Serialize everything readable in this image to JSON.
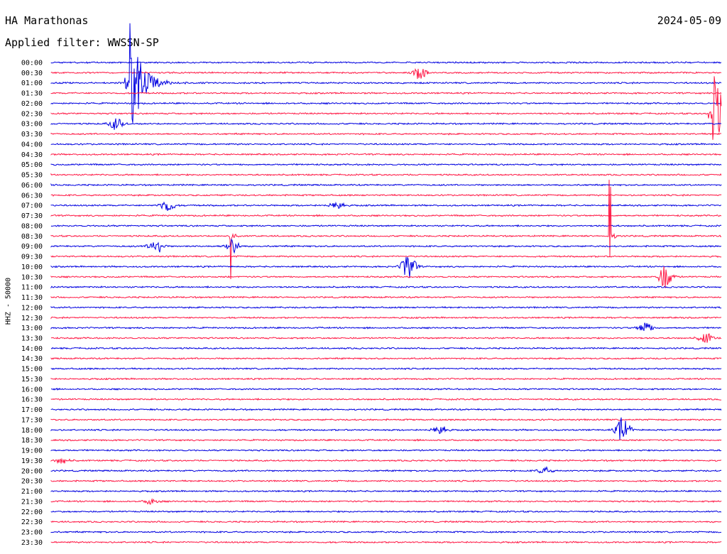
{
  "header": {
    "station": "HA Marathonas",
    "date": "2024-05-09",
    "filter": "Applied filter: WWSSN-SP"
  },
  "colors": {
    "blue": "#0000e0",
    "red": "#ff1744"
  },
  "chart_data": {
    "type": "line",
    "ylabel": "HHZ - 50000",
    "xlabel": "",
    "grid": false,
    "series_colors_alternate": [
      "blue",
      "red"
    ],
    "rows": [
      "00:00",
      "00:30",
      "01:00",
      "01:30",
      "02:00",
      "02:30",
      "03:00",
      "03:30",
      "04:00",
      "04:30",
      "05:00",
      "05:30",
      "06:00",
      "06:30",
      "07:00",
      "07:30",
      "08:00",
      "08:30",
      "09:00",
      "09:30",
      "10:00",
      "10:30",
      "11:00",
      "11:30",
      "12:00",
      "12:30",
      "13:00",
      "13:30",
      "14:00",
      "14:30",
      "15:00",
      "15:30",
      "16:00",
      "16:30",
      "17:00",
      "17:30",
      "18:00",
      "18:30",
      "19:00",
      "19:30",
      "20:00",
      "20:30",
      "21:00",
      "21:30",
      "22:00",
      "22:30",
      "23:00",
      "23:30"
    ],
    "events": [
      {
        "row": 1,
        "minute": 16.5,
        "amp": 9,
        "kind": "burst"
      },
      {
        "row": 2,
        "minute": 3.5,
        "amp": 90,
        "kind": "quake"
      },
      {
        "row": 5,
        "minute": 29.6,
        "amp": 70,
        "kind": "quake"
      },
      {
        "row": 6,
        "minute": 2.9,
        "amp": 8,
        "kind": "burst"
      },
      {
        "row": 14,
        "minute": 5.2,
        "amp": 9,
        "kind": "burst"
      },
      {
        "row": 14,
        "minute": 12.8,
        "amp": 6,
        "kind": "burst"
      },
      {
        "row": 17,
        "minute": 8.0,
        "amp": 55,
        "kind": "spike"
      },
      {
        "row": 17,
        "minute": 25.0,
        "amp": 115,
        "kind": "spike"
      },
      {
        "row": 18,
        "minute": 4.7,
        "amp": 12,
        "kind": "burst"
      },
      {
        "row": 18,
        "minute": 8.1,
        "amp": 10,
        "kind": "burst"
      },
      {
        "row": 20,
        "minute": 16.0,
        "amp": 20,
        "kind": "burst"
      },
      {
        "row": 21,
        "minute": 27.5,
        "amp": 16,
        "kind": "burst"
      },
      {
        "row": 26,
        "minute": 26.6,
        "amp": 8,
        "kind": "burst"
      },
      {
        "row": 27,
        "minute": 29.3,
        "amp": 7,
        "kind": "burst"
      },
      {
        "row": 36,
        "minute": 17.4,
        "amp": 7,
        "kind": "burst"
      },
      {
        "row": 36,
        "minute": 25.6,
        "amp": 18,
        "kind": "burst"
      },
      {
        "row": 39,
        "minute": 0.5,
        "amp": 4,
        "kind": "burst"
      },
      {
        "row": 40,
        "minute": 22.1,
        "amp": 5,
        "kind": "burst"
      },
      {
        "row": 43,
        "minute": 4.5,
        "amp": 4,
        "kind": "burst"
      }
    ]
  }
}
